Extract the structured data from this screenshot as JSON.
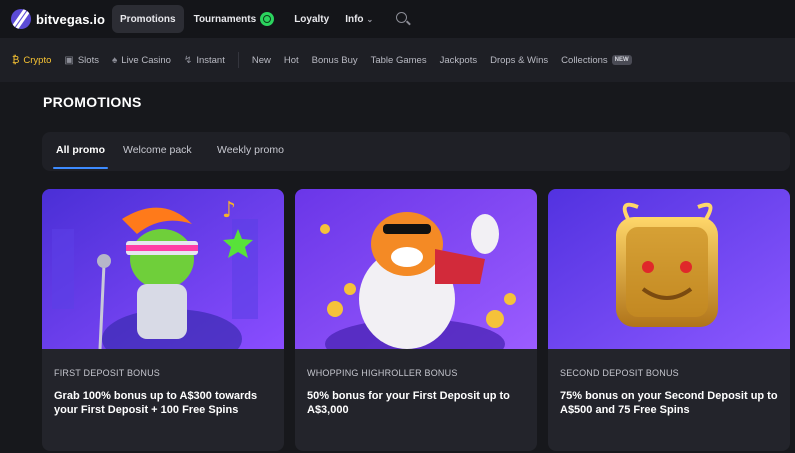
{
  "brand": {
    "name": "bitvegas.io"
  },
  "topnav": {
    "items": [
      {
        "label": "Promotions",
        "active": true
      },
      {
        "label": "Tournaments",
        "active": false
      },
      {
        "label": "Loyalty",
        "active": false
      },
      {
        "label": "Info",
        "active": false
      }
    ]
  },
  "categories": [
    {
      "label": "Crypto",
      "icon": "bitcoin-icon",
      "active": true
    },
    {
      "label": "Slots",
      "icon": "slot-machine-icon"
    },
    {
      "label": "Live Casino",
      "icon": "spade-icon"
    },
    {
      "label": "Instant",
      "icon": "lightning-icon"
    },
    {
      "label": "New"
    },
    {
      "label": "Hot"
    },
    {
      "label": "Bonus Buy"
    },
    {
      "label": "Table Games"
    },
    {
      "label": "Jackpots"
    },
    {
      "label": "Drops & Wins"
    },
    {
      "label": "Collections",
      "badge": "NEW"
    }
  ],
  "page": {
    "title": "PROMOTIONS"
  },
  "tabs": [
    {
      "label": "All promo",
      "active": true
    },
    {
      "label": "Welcome pack"
    },
    {
      "label": "Weekly promo"
    }
  ],
  "promos": [
    {
      "category": "FIRST DEPOSIT BONUS",
      "title": "Grab 100% bonus up to A$300 towards your First Deposit + 100 Free Spins",
      "image": "frog-rockstar-illustration"
    },
    {
      "category": "WHOPPING HIGHROLLER BONUS",
      "title": "50% bonus for your First Deposit up to A$3,000",
      "image": "tiger-coins-illustration"
    },
    {
      "category": "SECOND DEPOSIT BONUS",
      "title": "75% bonus on your Second Deposit up to A$500 and 75 Free Spins",
      "image": "golden-dragon-illustration"
    }
  ],
  "colors": {
    "accent_yellow": "#f7c333",
    "tab_underline": "#3d8bff",
    "promo_purple": "#6b3fe0"
  }
}
